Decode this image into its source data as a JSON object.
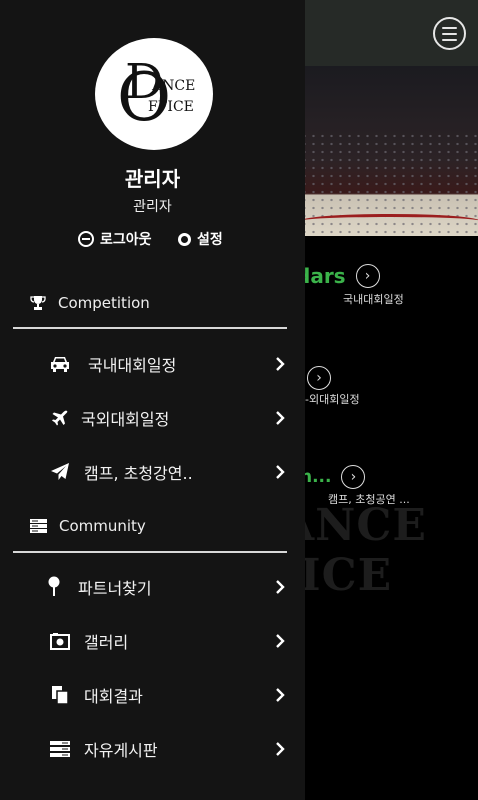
{
  "background": {
    "sections": [
      {
        "title": "dars",
        "caption": "국내대회일정"
      },
      {
        "title": "",
        "caption": "-외대회일정"
      },
      {
        "title": "n...",
        "caption": "캠프, 초청공연 ..."
      }
    ],
    "watermark": [
      "ANCE",
      "ICE"
    ],
    "accent_color": "#3bb34a"
  },
  "drawer": {
    "logo": {
      "letter_d": "D",
      "letter_o": "O",
      "text_top": "ANCE",
      "text_bottom": "FFICE"
    },
    "user_name": "관리자",
    "user_role": "관리자",
    "logout_label": "로그아웃",
    "settings_label": "설정",
    "groups": [
      {
        "title": "Competition",
        "icon": "trophy-icon",
        "items": [
          {
            "label": "국내대회일정",
            "icon": "car-icon"
          },
          {
            "label": "국외대회일정",
            "icon": "airplane-icon"
          },
          {
            "label": "캠프, 초청강연..",
            "icon": "paper-plane-icon"
          }
        ]
      },
      {
        "title": "Community",
        "icon": "server-icon",
        "items": [
          {
            "label": "파트너찾기",
            "icon": "map-pin-icon"
          },
          {
            "label": "갤러리",
            "icon": "camera-icon"
          },
          {
            "label": "대회결과",
            "icon": "documents-icon"
          },
          {
            "label": "자유게시판",
            "icon": "list-icon"
          }
        ]
      }
    ]
  }
}
